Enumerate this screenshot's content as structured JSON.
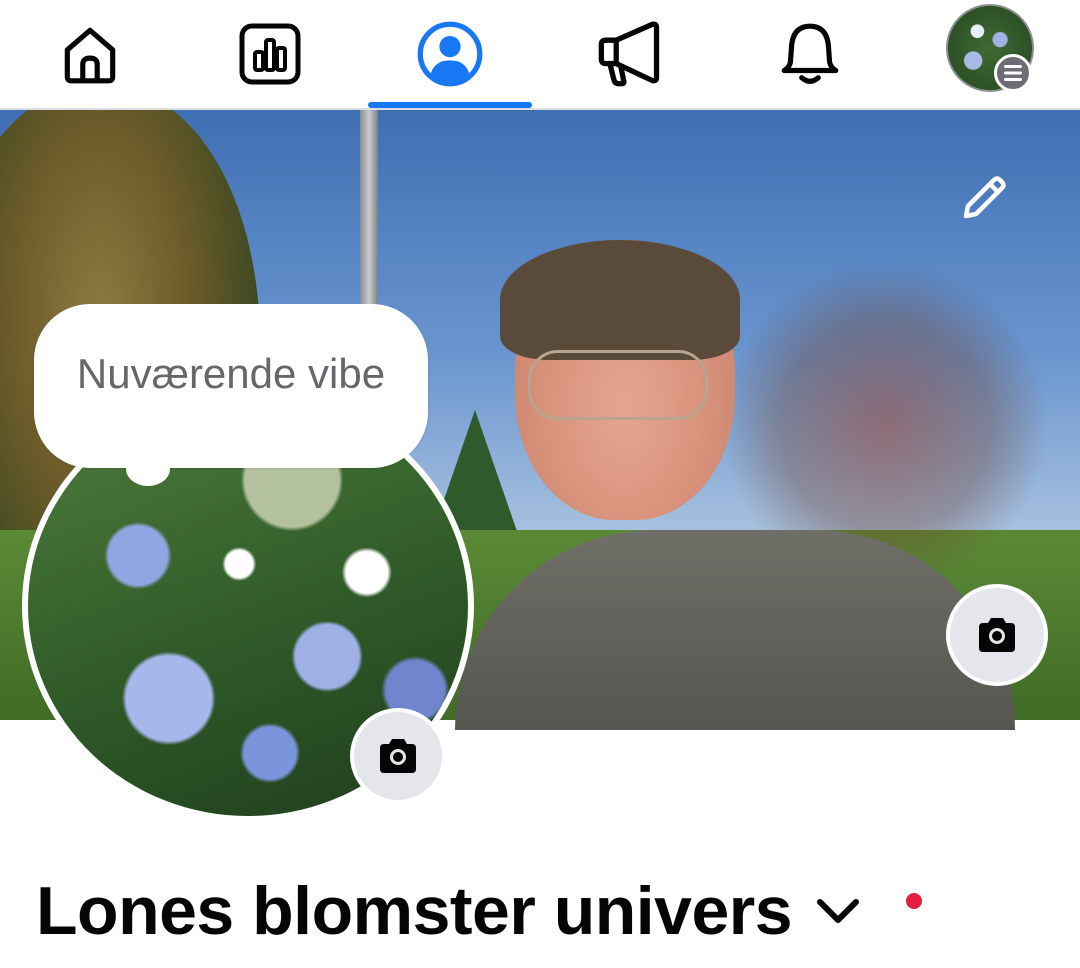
{
  "tabbar": {
    "tabs": [
      {
        "id": "home",
        "icon": "home-icon"
      },
      {
        "id": "insights",
        "icon": "bar-chart-icon"
      },
      {
        "id": "profile",
        "icon": "profile-icon",
        "active": true
      },
      {
        "id": "ads",
        "icon": "megaphone-icon"
      },
      {
        "id": "notifications",
        "icon": "bell-icon"
      },
      {
        "id": "menu",
        "icon": "avatar-menu-icon"
      }
    ],
    "accent_color": "#1877f2"
  },
  "cover": {
    "edit_icon": "pencil-icon",
    "camera_icon": "camera-icon"
  },
  "profile_picture": {
    "vibe_label": "Nuværende vibe",
    "camera_icon": "camera-icon"
  },
  "page": {
    "name": "Lones blomster univers",
    "switch_icon": "chevron-down-icon",
    "notification_dot_color": "#e41e3f"
  }
}
